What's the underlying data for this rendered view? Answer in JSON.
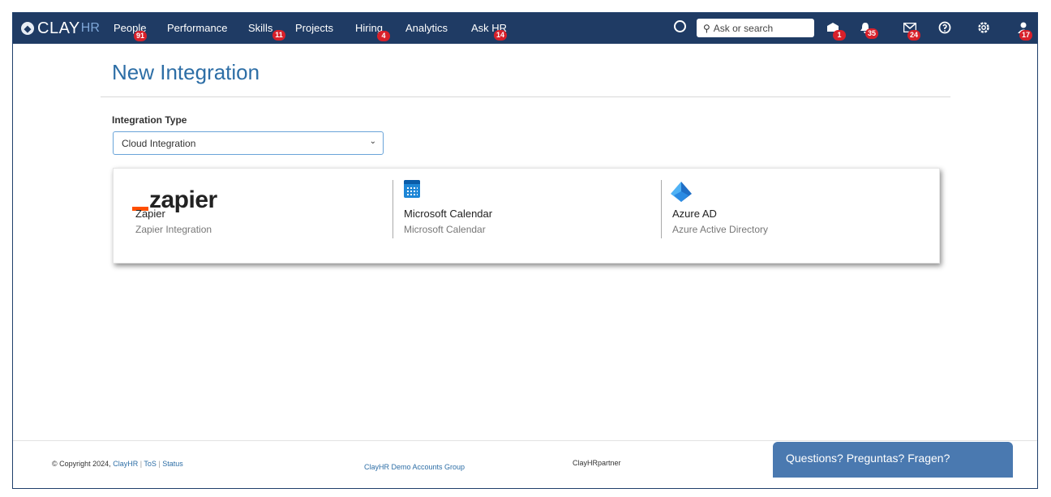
{
  "brand": {
    "logo_text": "CLAY",
    "logo_suffix": "HR"
  },
  "nav": {
    "items": [
      {
        "label": "People",
        "badge": "91"
      },
      {
        "label": "Performance",
        "badge": ""
      },
      {
        "label": "Skills",
        "badge": "11"
      },
      {
        "label": "Projects",
        "badge": ""
      },
      {
        "label": "Hiring",
        "badge": "4"
      },
      {
        "label": "Analytics",
        "badge": ""
      },
      {
        "label": "Ask HR",
        "badge": "14"
      }
    ]
  },
  "search": {
    "placeholder": "Ask or search"
  },
  "toolbar_icons": [
    {
      "icon": "inbox-tray-icon",
      "badge": "1"
    },
    {
      "icon": "bell-icon",
      "badge": "35"
    },
    {
      "icon": "mail-icon",
      "badge": "24"
    },
    {
      "icon": "help-icon",
      "badge": ""
    },
    {
      "icon": "gear-icon",
      "badge": ""
    },
    {
      "icon": "user-avatar-icon",
      "badge": "17"
    }
  ],
  "page": {
    "title": "New Integration",
    "integration_type_label": "Integration Type",
    "integration_type_value": "Cloud Integration"
  },
  "integrations": [
    {
      "logo_text": "zapier",
      "name": "Zapier",
      "description": "Zapier Integration",
      "icon": "zapier-logo"
    },
    {
      "name": "Microsoft Calendar",
      "description": "Microsoft Calendar",
      "icon": "calendar-icon",
      "color": "#1d86d6"
    },
    {
      "name": "Azure AD",
      "description": "Azure Active Directory",
      "icon": "azure-pyramid-icon",
      "color": "#2f8fe0"
    }
  ],
  "footer": {
    "copyright": "© Copyright 2024,",
    "company_link": "ClayHR",
    "sep": "|",
    "tos": "ToS",
    "status": "Status",
    "group": "ClayHR Demo Accounts Group",
    "partner": "ClayHRpartner"
  },
  "help_button": {
    "label": "Questions? Preguntas? Fragen?"
  },
  "colors": {
    "topbar": "#1f3b64",
    "accent": "#2d6ea6",
    "badge": "#d8202a",
    "zapier_orange": "#ff4f00"
  }
}
